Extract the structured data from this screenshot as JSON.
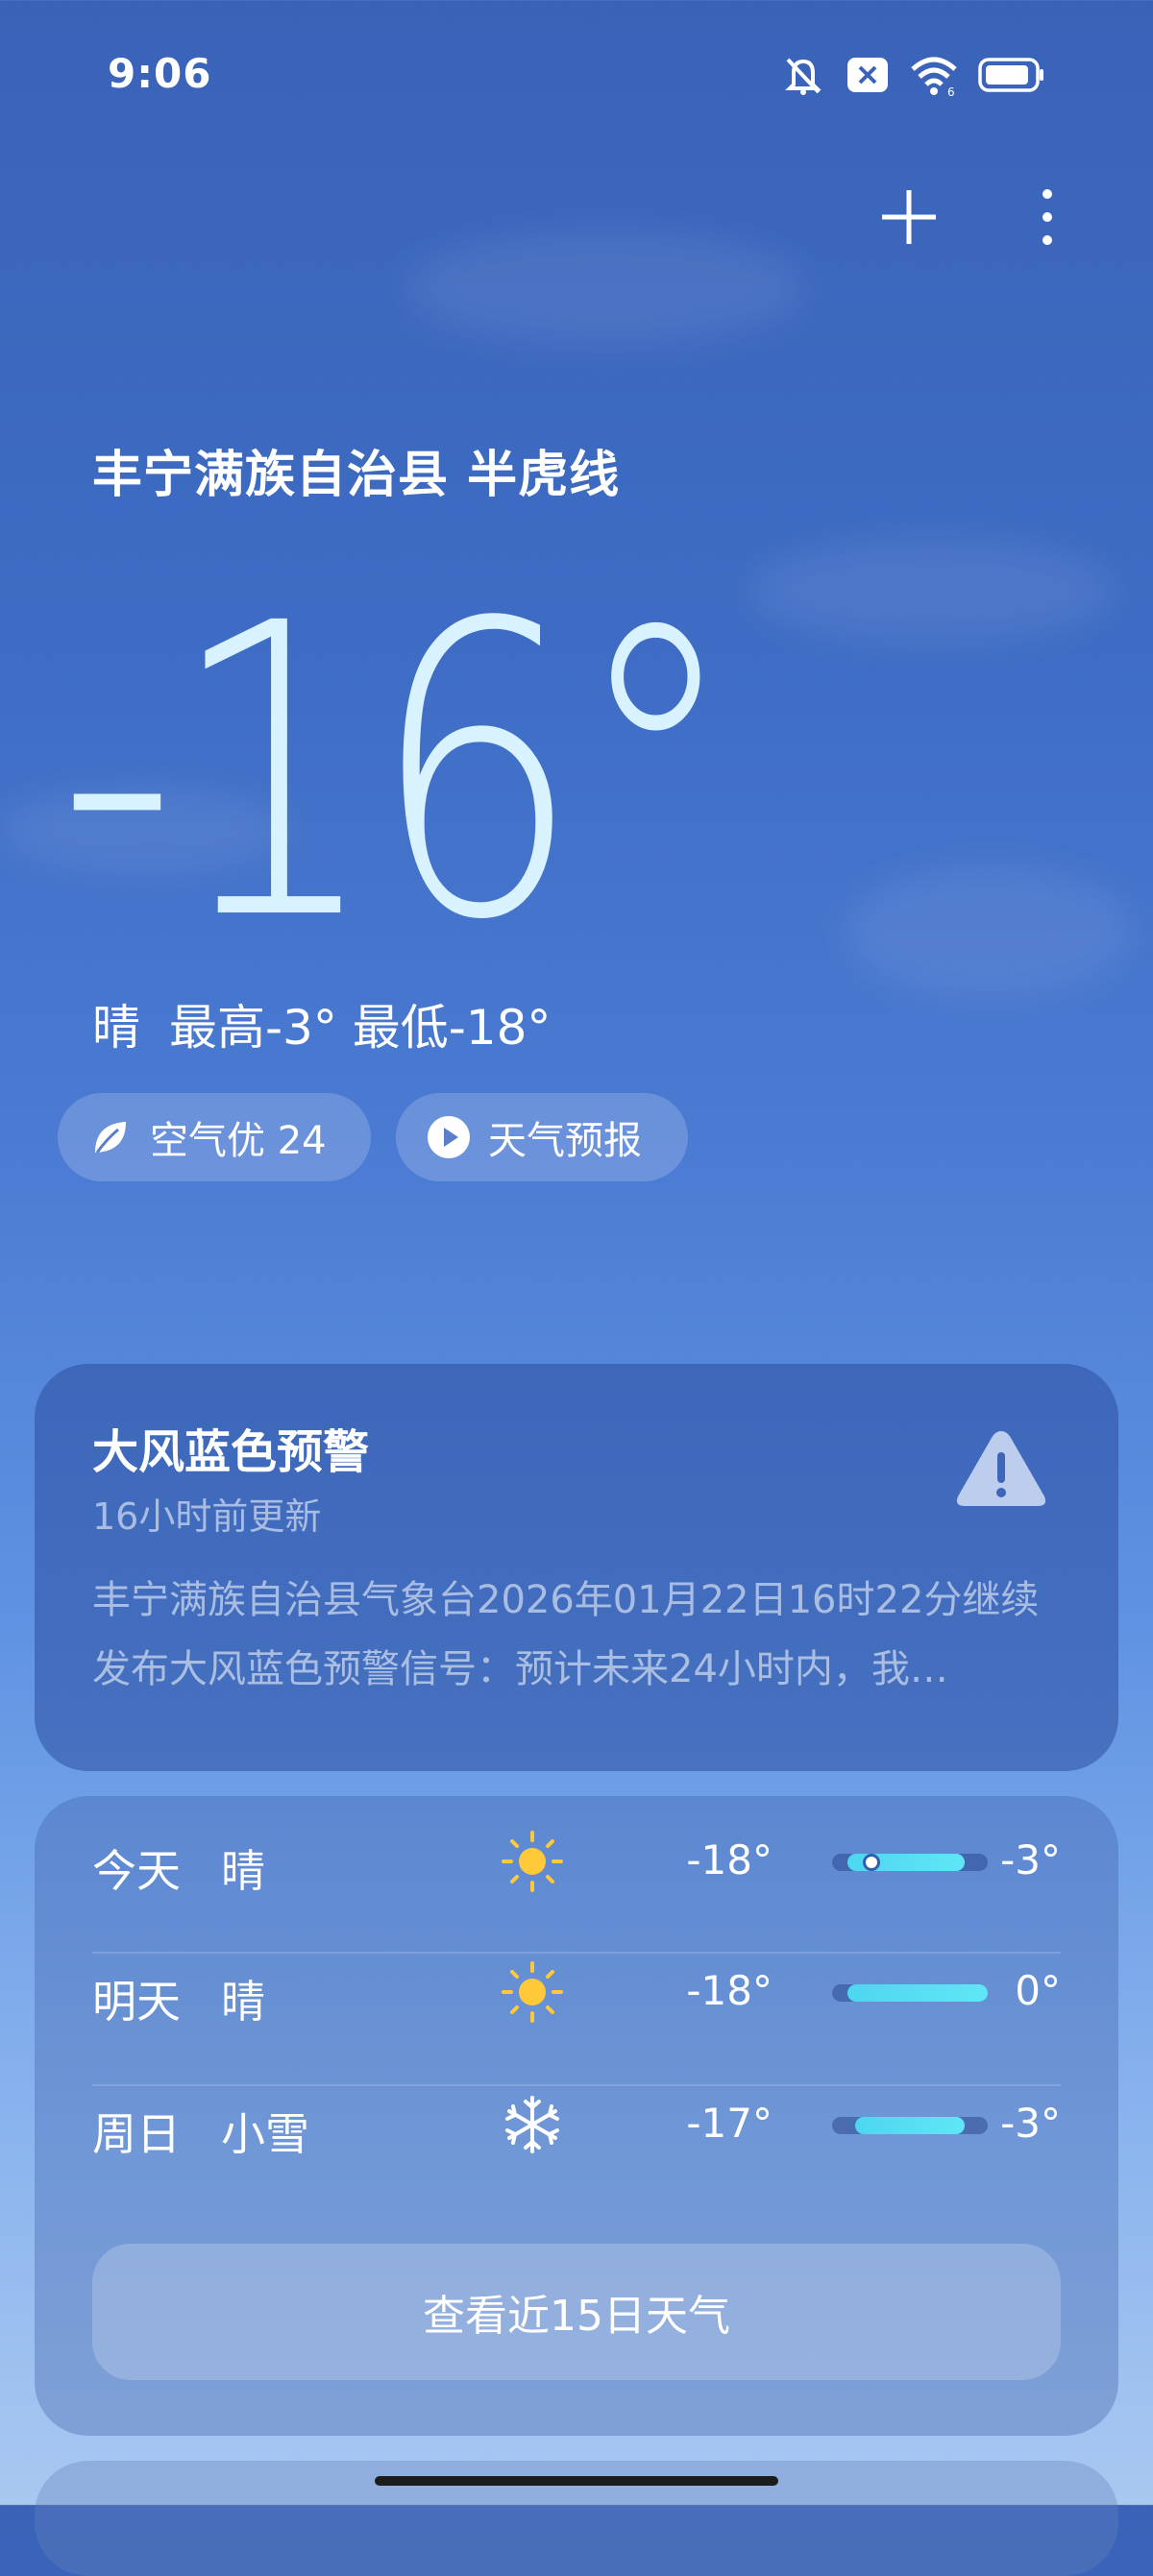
{
  "status_bar": {
    "time": "9:06",
    "icons": [
      "bell-muted-icon",
      "notification-x-icon",
      "wifi-6-icon",
      "battery-icon"
    ]
  },
  "toolbar": {
    "add_icon": "plus-icon",
    "more_icon": "more-vertical-icon"
  },
  "location": "丰宁满族自治县 半虎线",
  "current": {
    "temperature": "-16°",
    "condition": "晴",
    "high_low": "最高-3° 最低-18°"
  },
  "pills": {
    "air_quality": "空气优 24",
    "forecast_video": "天气预报"
  },
  "alert": {
    "title": "大风蓝色预警",
    "updated": "16小时前更新",
    "body": "丰宁满族自治县气象台2026年01月22日16时22分继续发布大风蓝色预警信号：预计未来24小时内，我…",
    "icon": "warning-triangle-icon"
  },
  "forecast": {
    "days": [
      {
        "day": "今天",
        "condition": "晴",
        "icon": "sun-icon",
        "low": "-18°",
        "high": "-3°",
        "range_start": 0.1,
        "range_end": 0.85,
        "current_marker": 0.2
      },
      {
        "day": "明天",
        "condition": "晴",
        "icon": "sun-icon",
        "low": "-18°",
        "high": "0°",
        "range_start": 0.1,
        "range_end": 1.0
      },
      {
        "day": "周日",
        "condition": "小雪",
        "icon": "snowflake-icon",
        "low": "-17°",
        "high": "-3°",
        "range_start": 0.15,
        "range_end": 0.85
      }
    ],
    "more_button": "查看近15日天气"
  },
  "colors": {
    "sky_top": "#3a63b8",
    "sky_bottom": "#a9c8f0",
    "temp_fill": "#d8f2ff",
    "bar_fill": "#4fd6f0",
    "sun": "#ffc93a"
  }
}
